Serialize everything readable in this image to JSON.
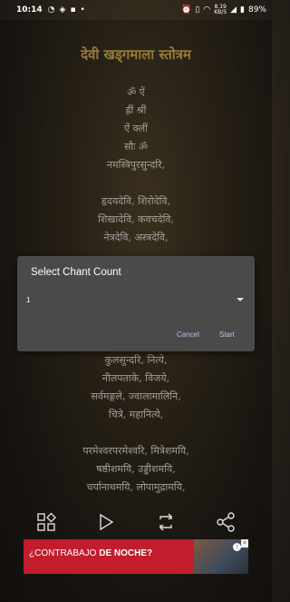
{
  "status_bar": {
    "time": "10:14",
    "speed_value": "8.19",
    "speed_unit": "KB/S",
    "battery": "89%"
  },
  "title": "देवी खड्गमाला स्तोत्रम",
  "verse_top": [
    "ॐ ऐं",
    "ह्रीं श्रीं",
    "ऐं क्लीं",
    "सौः ॐ",
    "नमस्त्रिपुरसुन्दरि,",
    "",
    "हृदयदेवि, शिरोदेवि,",
    "शिखादेवि, कवचदेवि,",
    "नेत्रदेवि, अस्त्रदेवि,"
  ],
  "verse_bottom": [
    "कुलसुन्दरि, नित्ये,",
    "नीलपताके, विजये,",
    "सर्वमङ्गले, ज्वालामालिनि,",
    "चित्रे, महानित्ये,",
    "",
    "परमेश्वरपरमेश्वरि, मित्रेशमयि,",
    "षष्ठीशमयि, उड्डीशमयि,",
    "चर्यानाथमयि, लोपामुद्रामयि,"
  ],
  "dialog": {
    "title": "Select Chant Count",
    "selected_value": "1",
    "cancel_label": "Cancel",
    "start_label": "Start"
  },
  "toolbar": {
    "icons": [
      "shapes-icon",
      "play-icon",
      "repeat-icon",
      "share-icon"
    ]
  },
  "ad": {
    "text_prefix": "¿CONTRABAJO ",
    "text_bold": "DE NOCHE?",
    "bg_color": "#c11d2c"
  },
  "colors": {
    "title": "#e7bf4f",
    "accent_button": "#c5b9f0",
    "dialog_bg": "#4a4a4a"
  }
}
